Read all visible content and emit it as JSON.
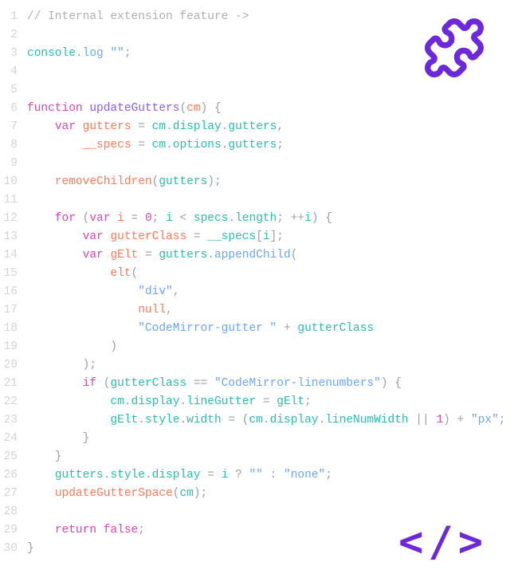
{
  "icons": {
    "puzzle": "puzzle-icon",
    "code_angle": "</>"
  },
  "colors": {
    "accent": "#6d28d9",
    "gutter": "#d4d4d8"
  },
  "lines": [
    {
      "n": 1,
      "tokens": [
        {
          "t": "// Internal extension feature ->",
          "c": "tok-comment"
        }
      ]
    },
    {
      "n": 2,
      "tokens": []
    },
    {
      "n": 3,
      "tokens": [
        {
          "t": "console",
          "c": "tok-prop"
        },
        {
          "t": ".",
          "c": "tok-punc"
        },
        {
          "t": "log",
          "c": "tok-method"
        },
        {
          "t": " ",
          "c": "tok-punc"
        },
        {
          "t": "\"\"",
          "c": "tok-str"
        },
        {
          "t": ";",
          "c": "tok-punc"
        }
      ]
    },
    {
      "n": 4,
      "tokens": []
    },
    {
      "n": 5,
      "tokens": []
    },
    {
      "n": 6,
      "tokens": [
        {
          "t": "function",
          "c": "tok-kw"
        },
        {
          "t": " ",
          "c": ""
        },
        {
          "t": "updateGutters",
          "c": "tok-fn"
        },
        {
          "t": "(",
          "c": "tok-punc"
        },
        {
          "t": "cm",
          "c": "tok-param"
        },
        {
          "t": ")",
          "c": "tok-punc"
        },
        {
          "t": " {",
          "c": "tok-punc"
        }
      ]
    },
    {
      "n": 7,
      "tokens": [
        {
          "t": "    ",
          "c": ""
        },
        {
          "t": "var",
          "c": "tok-kw"
        },
        {
          "t": " ",
          "c": ""
        },
        {
          "t": "gutters",
          "c": "tok-var"
        },
        {
          "t": " = ",
          "c": "tok-punc"
        },
        {
          "t": "cm",
          "c": "tok-prop"
        },
        {
          "t": ".",
          "c": "tok-punc"
        },
        {
          "t": "display",
          "c": "tok-prop"
        },
        {
          "t": ".",
          "c": "tok-punc"
        },
        {
          "t": "gutters",
          "c": "tok-prop"
        },
        {
          "t": ",",
          "c": "tok-punc"
        }
      ]
    },
    {
      "n": 8,
      "tokens": [
        {
          "t": "        ",
          "c": ""
        },
        {
          "t": "__specs",
          "c": "tok-var"
        },
        {
          "t": " = ",
          "c": "tok-punc"
        },
        {
          "t": "cm",
          "c": "tok-prop"
        },
        {
          "t": ".",
          "c": "tok-punc"
        },
        {
          "t": "options",
          "c": "tok-prop"
        },
        {
          "t": ".",
          "c": "tok-punc"
        },
        {
          "t": "gutters",
          "c": "tok-prop"
        },
        {
          "t": ";",
          "c": "tok-punc"
        }
      ]
    },
    {
      "n": 9,
      "tokens": []
    },
    {
      "n": 10,
      "tokens": [
        {
          "t": "    ",
          "c": ""
        },
        {
          "t": "removeChildren",
          "c": "tok-var"
        },
        {
          "t": "(",
          "c": "tok-punc"
        },
        {
          "t": "gutters",
          "c": "tok-prop"
        },
        {
          "t": ")",
          "c": "tok-punc"
        },
        {
          "t": ";",
          "c": "tok-punc"
        }
      ]
    },
    {
      "n": 11,
      "tokens": []
    },
    {
      "n": 12,
      "tokens": [
        {
          "t": "    ",
          "c": ""
        },
        {
          "t": "for",
          "c": "tok-kw"
        },
        {
          "t": " (",
          "c": "tok-punc"
        },
        {
          "t": "var",
          "c": "tok-kw"
        },
        {
          "t": " ",
          "c": ""
        },
        {
          "t": "i",
          "c": "tok-var"
        },
        {
          "t": " = ",
          "c": "tok-punc"
        },
        {
          "t": "0",
          "c": "tok-num"
        },
        {
          "t": "; ",
          "c": "tok-punc"
        },
        {
          "t": "i",
          "c": "tok-prop"
        },
        {
          "t": " < ",
          "c": "tok-punc"
        },
        {
          "t": "specs",
          "c": "tok-prop"
        },
        {
          "t": ".",
          "c": "tok-punc"
        },
        {
          "t": "length",
          "c": "tok-prop"
        },
        {
          "t": "; ",
          "c": "tok-punc"
        },
        {
          "t": "++",
          "c": "tok-punc"
        },
        {
          "t": "i",
          "c": "tok-prop"
        },
        {
          "t": ") {",
          "c": "tok-punc"
        }
      ]
    },
    {
      "n": 13,
      "tokens": [
        {
          "t": "        ",
          "c": ""
        },
        {
          "t": "var",
          "c": "tok-kw"
        },
        {
          "t": " ",
          "c": ""
        },
        {
          "t": "gutterClass",
          "c": "tok-var"
        },
        {
          "t": " = ",
          "c": "tok-punc"
        },
        {
          "t": "__specs",
          "c": "tok-prop"
        },
        {
          "t": "[",
          "c": "tok-punc"
        },
        {
          "t": "i",
          "c": "tok-prop"
        },
        {
          "t": "];",
          "c": "tok-punc"
        }
      ]
    },
    {
      "n": 14,
      "tokens": [
        {
          "t": "        ",
          "c": ""
        },
        {
          "t": "var",
          "c": "tok-kw"
        },
        {
          "t": " ",
          "c": ""
        },
        {
          "t": "gElt",
          "c": "tok-var"
        },
        {
          "t": " = ",
          "c": "tok-punc"
        },
        {
          "t": "gutters",
          "c": "tok-prop"
        },
        {
          "t": ".",
          "c": "tok-punc"
        },
        {
          "t": "appendChild",
          "c": "tok-method"
        },
        {
          "t": "(",
          "c": "tok-punc"
        }
      ]
    },
    {
      "n": 15,
      "tokens": [
        {
          "t": "            ",
          "c": ""
        },
        {
          "t": "elt",
          "c": "tok-var"
        },
        {
          "t": "(",
          "c": "tok-punc"
        }
      ]
    },
    {
      "n": 16,
      "tokens": [
        {
          "t": "                ",
          "c": ""
        },
        {
          "t": "\"div\"",
          "c": "tok-str"
        },
        {
          "t": ",",
          "c": "tok-punc"
        }
      ]
    },
    {
      "n": 17,
      "tokens": [
        {
          "t": "                ",
          "c": ""
        },
        {
          "t": "null",
          "c": "tok-null"
        },
        {
          "t": ",",
          "c": "tok-punc"
        }
      ]
    },
    {
      "n": 18,
      "tokens": [
        {
          "t": "                ",
          "c": ""
        },
        {
          "t": "\"CodeMirror-gutter \"",
          "c": "tok-str"
        },
        {
          "t": " + ",
          "c": "tok-punc"
        },
        {
          "t": "gutterClass",
          "c": "tok-prop"
        }
      ]
    },
    {
      "n": 19,
      "tokens": [
        {
          "t": "            )",
          "c": "tok-punc"
        }
      ]
    },
    {
      "n": 20,
      "tokens": [
        {
          "t": "        );",
          "c": "tok-punc"
        }
      ]
    },
    {
      "n": 21,
      "tokens": [
        {
          "t": "        ",
          "c": ""
        },
        {
          "t": "if",
          "c": "tok-kw"
        },
        {
          "t": " (",
          "c": "tok-punc"
        },
        {
          "t": "gutterClass",
          "c": "tok-prop"
        },
        {
          "t": " == ",
          "c": "tok-punc"
        },
        {
          "t": "\"CodeMirror-linenumbers\"",
          "c": "tok-str"
        },
        {
          "t": ") {",
          "c": "tok-punc"
        }
      ]
    },
    {
      "n": 22,
      "tokens": [
        {
          "t": "            ",
          "c": ""
        },
        {
          "t": "cm",
          "c": "tok-prop"
        },
        {
          "t": ".",
          "c": "tok-punc"
        },
        {
          "t": "display",
          "c": "tok-prop"
        },
        {
          "t": ".",
          "c": "tok-punc"
        },
        {
          "t": "lineGutter",
          "c": "tok-prop"
        },
        {
          "t": " = ",
          "c": "tok-punc"
        },
        {
          "t": "gElt",
          "c": "tok-prop"
        },
        {
          "t": ";",
          "c": "tok-punc"
        }
      ]
    },
    {
      "n": 23,
      "tokens": [
        {
          "t": "            ",
          "c": ""
        },
        {
          "t": "gElt",
          "c": "tok-prop"
        },
        {
          "t": ".",
          "c": "tok-punc"
        },
        {
          "t": "style",
          "c": "tok-prop"
        },
        {
          "t": ".",
          "c": "tok-punc"
        },
        {
          "t": "width",
          "c": "tok-prop"
        },
        {
          "t": " = (",
          "c": "tok-punc"
        },
        {
          "t": "cm",
          "c": "tok-prop"
        },
        {
          "t": ".",
          "c": "tok-punc"
        },
        {
          "t": "display",
          "c": "tok-prop"
        },
        {
          "t": ".",
          "c": "tok-punc"
        },
        {
          "t": "lineNumWidth",
          "c": "tok-prop"
        },
        {
          "t": " || ",
          "c": "tok-punc"
        },
        {
          "t": "1",
          "c": "tok-num"
        },
        {
          "t": ") + ",
          "c": "tok-punc"
        },
        {
          "t": "\"px\"",
          "c": "tok-str"
        },
        {
          "t": ";",
          "c": "tok-punc"
        }
      ]
    },
    {
      "n": 24,
      "tokens": [
        {
          "t": "        }",
          "c": "tok-punc"
        }
      ]
    },
    {
      "n": 25,
      "tokens": [
        {
          "t": "    }",
          "c": "tok-punc"
        }
      ]
    },
    {
      "n": 26,
      "tokens": [
        {
          "t": "    ",
          "c": ""
        },
        {
          "t": "gutters",
          "c": "tok-prop"
        },
        {
          "t": ".",
          "c": "tok-punc"
        },
        {
          "t": "style",
          "c": "tok-prop"
        },
        {
          "t": ".",
          "c": "tok-punc"
        },
        {
          "t": "display",
          "c": "tok-prop"
        },
        {
          "t": " = ",
          "c": "tok-punc"
        },
        {
          "t": "i",
          "c": "tok-prop"
        },
        {
          "t": " ? ",
          "c": "tok-punc"
        },
        {
          "t": "\"\"",
          "c": "tok-str"
        },
        {
          "t": " : ",
          "c": "tok-punc"
        },
        {
          "t": "\"none\"",
          "c": "tok-str"
        },
        {
          "t": ";",
          "c": "tok-punc"
        }
      ]
    },
    {
      "n": 27,
      "tokens": [
        {
          "t": "    ",
          "c": ""
        },
        {
          "t": "updateGutterSpace",
          "c": "tok-var"
        },
        {
          "t": "(",
          "c": "tok-punc"
        },
        {
          "t": "cm",
          "c": "tok-prop"
        },
        {
          "t": ")",
          "c": "tok-punc"
        },
        {
          "t": ";",
          "c": "tok-punc"
        }
      ]
    },
    {
      "n": 28,
      "tokens": []
    },
    {
      "n": 29,
      "tokens": [
        {
          "t": "    ",
          "c": ""
        },
        {
          "t": "return",
          "c": "tok-kw"
        },
        {
          "t": " ",
          "c": ""
        },
        {
          "t": "false",
          "c": "tok-bool"
        },
        {
          "t": ";",
          "c": "tok-punc"
        }
      ]
    },
    {
      "n": 30,
      "tokens": [
        {
          "t": "}",
          "c": "tok-punc"
        }
      ]
    }
  ]
}
